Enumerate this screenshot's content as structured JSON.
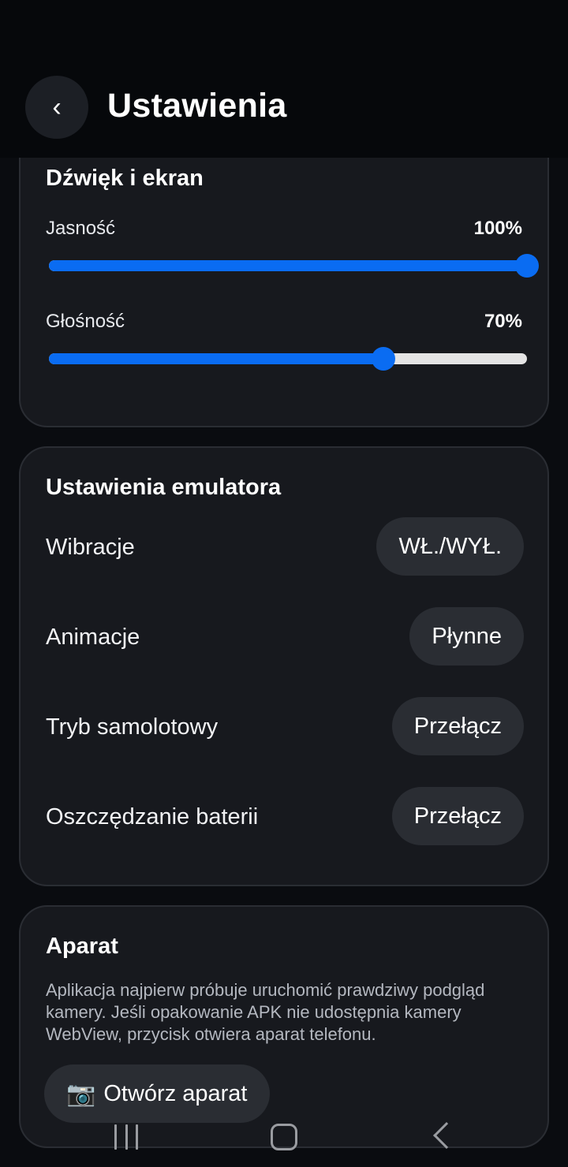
{
  "header": {
    "back_glyph": "‹",
    "title": "Ustawienia"
  },
  "sound_display": {
    "title": "Dźwięk i ekran",
    "brightness": {
      "label": "Jasność",
      "value_text": "100%",
      "value": 1.0
    },
    "volume": {
      "label": "Głośność",
      "value_text": "70%",
      "value": 0.7
    },
    "accent_color": "#0a6cf2"
  },
  "emulator": {
    "title": "Ustawienia emulatora",
    "rows": [
      {
        "label": "Wibracje",
        "button": "WŁ./WYŁ."
      },
      {
        "label": "Animacje",
        "button": "Płynne"
      },
      {
        "label": "Tryb samolotowy",
        "button": "Przełącz"
      },
      {
        "label": "Oszczędzanie baterii",
        "button": "Przełącz"
      }
    ]
  },
  "camera": {
    "title": "Aparat",
    "description": "Aplikacja najpierw próbuje uruchomić prawdziwy podgląd kamery. Jeśli opakowanie APK nie udostępnia kamery WebView, przycisk otwiera aparat telefonu.",
    "button_icon": "📷",
    "button_label": "Otwórz aparat"
  },
  "navbar": {
    "icons": [
      "recents-icon",
      "home-icon",
      "back-icon"
    ]
  }
}
